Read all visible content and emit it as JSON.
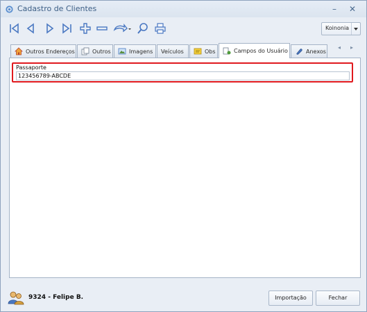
{
  "window": {
    "title": "Cadastro de Clientes"
  },
  "toolbar": {
    "buttons": [
      "first-record",
      "previous-record",
      "next-record",
      "last-record",
      "add-record",
      "remove-record",
      "undo",
      "search",
      "print"
    ]
  },
  "company_selector": {
    "label": "Koinonia"
  },
  "tabs": [
    {
      "label": "Outros Endereços",
      "icon": "house-icon"
    },
    {
      "label": "Outros",
      "icon": "documents-icon"
    },
    {
      "label": "Imagens",
      "icon": "image-icon"
    },
    {
      "label": "Veículos",
      "icon": ""
    },
    {
      "label": "Obs",
      "icon": "note-icon"
    },
    {
      "label": "Campos do Usuário",
      "icon": "user-fields-icon",
      "active": true
    },
    {
      "label": "Anexos",
      "icon": "paperclip-icon"
    }
  ],
  "user_fields": {
    "field_label": "Passaporte",
    "field_value": "123456789-ABCDE"
  },
  "footer": {
    "user_code": "9324",
    "separator": " - ",
    "user_name": "Felipe B.",
    "import_label": "Importação",
    "close_label": "Fechar"
  },
  "colors": {
    "accent": "#3d5f86",
    "highlight_border": "#e0191e",
    "toolbar_icon": "#4a78c2"
  }
}
